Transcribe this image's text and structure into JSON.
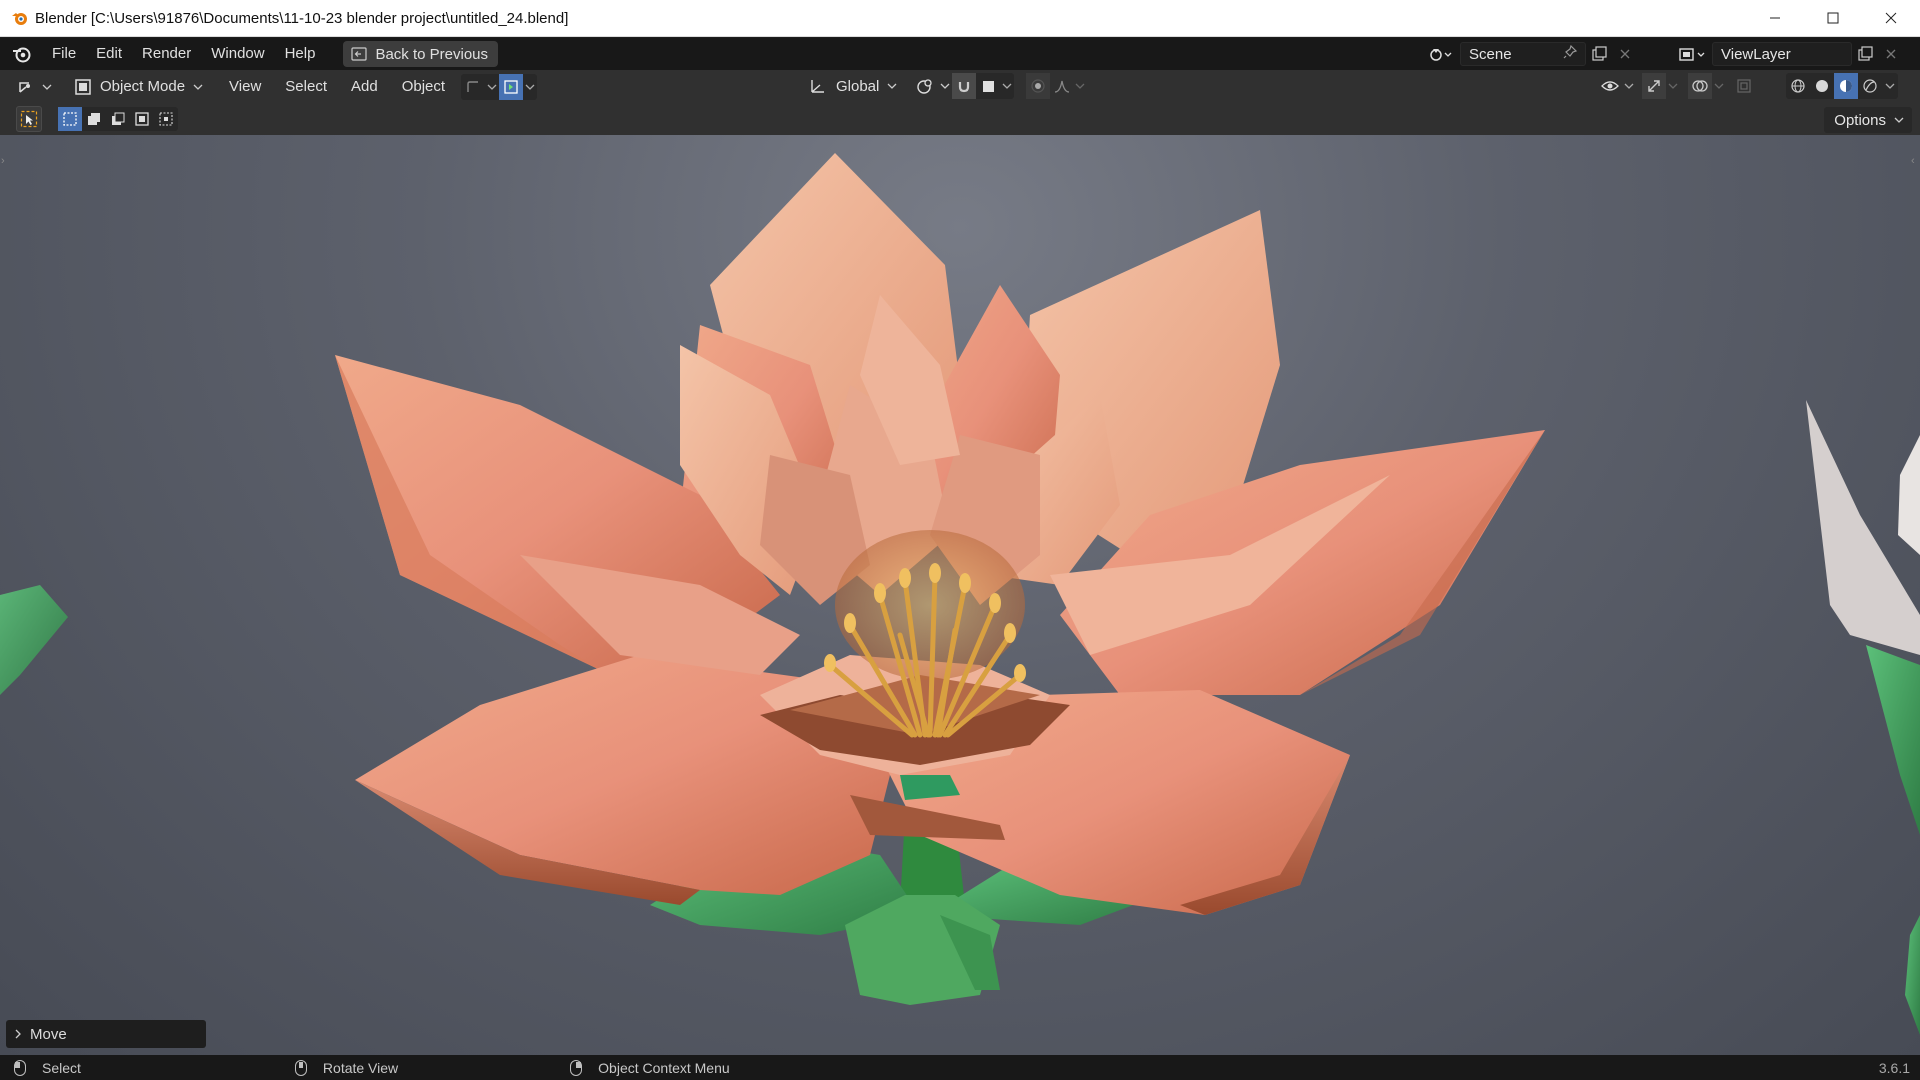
{
  "window": {
    "title": "Blender [C:\\Users\\91876\\Documents\\11-10-23 blender project\\untitled_24.blend]",
    "controls": [
      "minimize-icon",
      "maximize-icon",
      "close-icon"
    ]
  },
  "topbar": {
    "menus": [
      "File",
      "Edit",
      "Render",
      "Window",
      "Help"
    ],
    "back_button": "Back to Previous",
    "scene_name": "Scene",
    "view_layer": "ViewLayer"
  },
  "viewport_header": {
    "mode": "Object Mode",
    "menus": [
      "View",
      "Select",
      "Add",
      "Object"
    ],
    "transform_orientation": "Global"
  },
  "tool_settings": {
    "options_label": "Options"
  },
  "last_operator": {
    "label": "Move"
  },
  "statusbar": {
    "hint_left": "Select",
    "hint_middle": "Rotate View",
    "hint_right": "Object Context Menu",
    "version": "3.6.1"
  },
  "colors": {
    "accent": "#4772b3",
    "header_bg": "#303030",
    "topbar_bg": "#181818",
    "petal_main": "#e8967a",
    "leaf_green": "#3e9d5a"
  }
}
